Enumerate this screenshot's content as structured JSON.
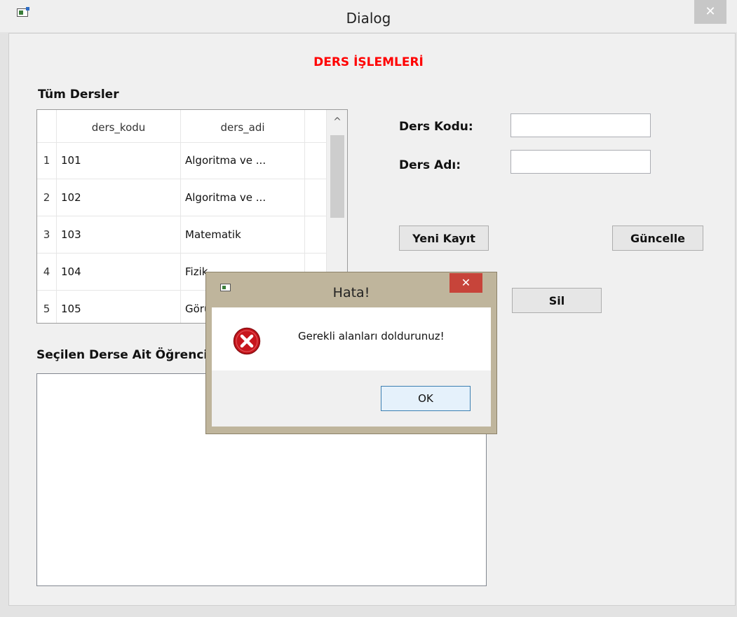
{
  "window": {
    "title": "Dialog",
    "close_glyph": "✕",
    "icon": "app-icon"
  },
  "heading": "DERS İŞLEMLERİ",
  "courses_label": "Tüm Dersler",
  "table": {
    "columns": [
      "ders_kodu",
      "ders_adi"
    ],
    "rows": [
      {
        "num": "1",
        "ders_kodu": "101",
        "ders_adi": "Algoritma ve ..."
      },
      {
        "num": "2",
        "ders_kodu": "102",
        "ders_adi": "Algoritma ve ..."
      },
      {
        "num": "3",
        "ders_kodu": "103",
        "ders_adi": "Matematik"
      },
      {
        "num": "4",
        "ders_kodu": "104",
        "ders_adi": "Fizik"
      },
      {
        "num": "5",
        "ders_kodu": "105",
        "ders_adi": "Görüntü İşleme"
      }
    ],
    "scroll_up_glyph": "^"
  },
  "form": {
    "code_label": "Ders Kodu:",
    "code_value": "",
    "name_label": "Ders Adı:",
    "name_value": ""
  },
  "buttons": {
    "new": "Yeni Kayıt",
    "update": "Güncelle",
    "delete": "Sil"
  },
  "students_label": "Seçilen Derse Ait Öğrenciler",
  "message_box": {
    "title": "Hata!",
    "close_glyph": "✕",
    "text": "Gerekli alanları doldurunuz!",
    "ok": "OK",
    "icon": "error-icon"
  },
  "colors": {
    "heading": "#ff0000",
    "msgbox_frame": "#bfb59c",
    "msgbox_close": "#c7443a",
    "error_icon": "#c8161d"
  }
}
